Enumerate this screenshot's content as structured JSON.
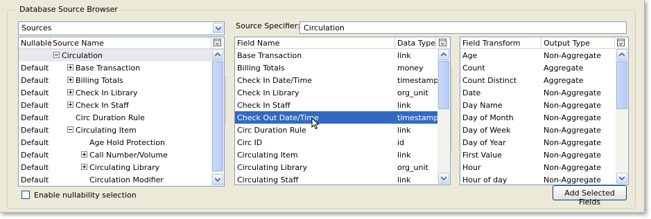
{
  "group_title": "Database Source Browser",
  "sources_combo": {
    "value": "Sources"
  },
  "left_table": {
    "columns": [
      "Nullable",
      "Source Name"
    ],
    "rows": [
      {
        "nullable": "",
        "name": "Circulation",
        "expander": "minus",
        "indent": 0
      },
      {
        "nullable": "Default",
        "name": "Base Transaction",
        "expander": "plus",
        "indent": 1
      },
      {
        "nullable": "Default",
        "name": "Billing Totals",
        "expander": "plus",
        "indent": 1
      },
      {
        "nullable": "Default",
        "name": "Check In Library",
        "expander": "plus",
        "indent": 1
      },
      {
        "nullable": "Default",
        "name": "Check In Staff",
        "expander": "plus",
        "indent": 1
      },
      {
        "nullable": "Default",
        "name": "Circ Duration Rule",
        "expander": "none",
        "indent": 1
      },
      {
        "nullable": "Default",
        "name": "Circulating Item",
        "expander": "minus",
        "indent": 1
      },
      {
        "nullable": "Default",
        "name": "Age Hold Protection",
        "expander": "none",
        "indent": 2
      },
      {
        "nullable": "Default",
        "name": "Call Number/Volume",
        "expander": "plus",
        "indent": 2
      },
      {
        "nullable": "Default",
        "name": "Circulating Library",
        "expander": "plus",
        "indent": 2
      },
      {
        "nullable": "Default",
        "name": "Circulation Modifier",
        "expander": "none",
        "indent": 2
      }
    ]
  },
  "enable_nullability": {
    "label": "Enable nullability selection",
    "checked": false
  },
  "source_specifier": {
    "label": "Source Specifier:",
    "value": "Circulation"
  },
  "field_table": {
    "columns": [
      "Field Name",
      "Data Type"
    ],
    "selected_index": 5,
    "rows": [
      {
        "name": "Base Transaction",
        "type": "link"
      },
      {
        "name": "Billing Totals",
        "type": "money"
      },
      {
        "name": "Check In Date/Time",
        "type": "timestamp"
      },
      {
        "name": "Check In Library",
        "type": "org_unit"
      },
      {
        "name": "Check In Staff",
        "type": "link"
      },
      {
        "name": "Check Out Date/Time",
        "type": "timestamp"
      },
      {
        "name": "Circ Duration Rule",
        "type": "link"
      },
      {
        "name": "Circ ID",
        "type": "id"
      },
      {
        "name": "Circulating Item",
        "type": "link"
      },
      {
        "name": "Circulating Library",
        "type": "org_unit"
      },
      {
        "name": "Circulating Staff",
        "type": "link"
      }
    ]
  },
  "transform_table": {
    "columns": [
      "Field Transform",
      "Output Type"
    ],
    "rows": [
      {
        "name": "Age",
        "type": "Non-Aggregate"
      },
      {
        "name": "Count",
        "type": "Aggregate"
      },
      {
        "name": "Count Distinct",
        "type": "Aggregate"
      },
      {
        "name": "Date",
        "type": "Non-Aggregate"
      },
      {
        "name": "Day Name",
        "type": "Non-Aggregate"
      },
      {
        "name": "Day of Month",
        "type": "Non-Aggregate"
      },
      {
        "name": "Day of Week",
        "type": "Non-Aggregate"
      },
      {
        "name": "Day of Year",
        "type": "Non-Aggregate"
      },
      {
        "name": "First Value",
        "type": "Non-Aggregate"
      },
      {
        "name": "Hour",
        "type": "Non-Aggregate"
      },
      {
        "name": "Hour of day",
        "type": "Non-Aggregate"
      }
    ]
  },
  "add_button": {
    "label": "Add Selected Fields"
  },
  "colors": {
    "selection": "#316ac5",
    "border": "#7f9db9",
    "window": "#ece9d8"
  },
  "icons": [
    "combo-arrow-icon",
    "column-picker-icon",
    "scroll-up-icon",
    "scroll-down-icon",
    "mouse-pointer-icon"
  ]
}
